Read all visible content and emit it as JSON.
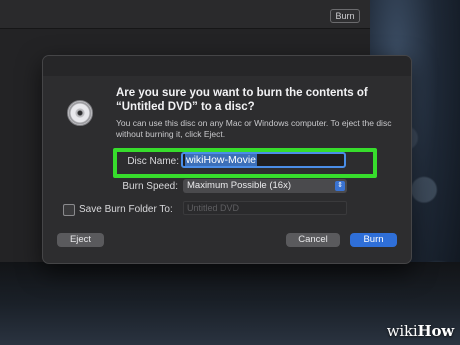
{
  "background": {
    "toolbar_button": "Burn"
  },
  "dialog": {
    "icon": "dvd-disc-icon",
    "title": "Are you sure you want to burn the contents of “Untitled DVD” to a disc?",
    "description": "You can use this disc on any Mac or Windows computer. To eject the disc without burning it, click Eject.",
    "disc_name_label": "Disc Name:",
    "disc_name_value": "wikiHow-Movie",
    "burn_speed_label": "Burn Speed:",
    "burn_speed_value": "Maximum Possible (16x)",
    "save_folder_label": "Save Burn Folder To:",
    "save_folder_placeholder": "Untitled DVD",
    "save_folder_checked": false,
    "eject_label": "Eject",
    "cancel_label": "Cancel",
    "burn_label": "Burn",
    "highlight_color": "#37dd2c",
    "accent_color": "#2f6fd8"
  },
  "watermark": {
    "prefix": "wiki",
    "suffix": "How"
  }
}
